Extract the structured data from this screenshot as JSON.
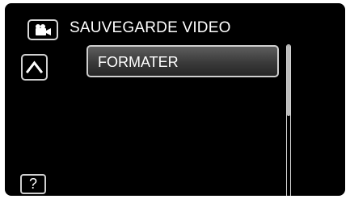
{
  "header": {
    "mode_icon": "video-camera-icon",
    "title": "SAUVEGARDE VIDEO"
  },
  "nav": {
    "up_icon": "chevron-up-icon"
  },
  "menu": {
    "items": [
      {
        "label": "FORMATER"
      }
    ]
  },
  "scrollbar": {
    "position": 0.0,
    "visible_fraction": 0.47
  },
  "help": {
    "label": "?"
  }
}
